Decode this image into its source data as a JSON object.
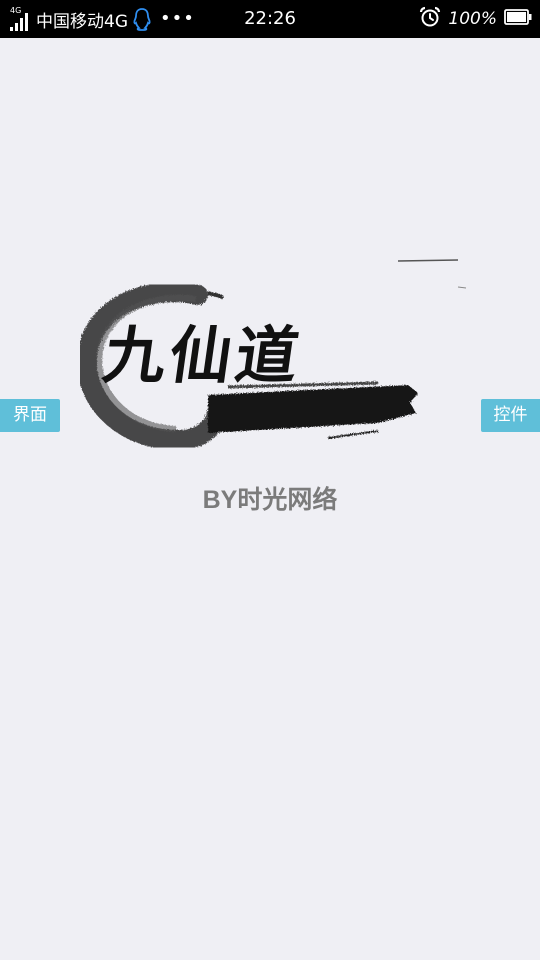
{
  "status_bar": {
    "network_badge": "4G",
    "carrier": "中国移动4G",
    "more_indicator": "•••",
    "time": "22:26",
    "battery_percent": "100%",
    "battery_level": 1.0,
    "icons": [
      "signal-icon",
      "qq-icon",
      "more-dots-icon",
      "alarm-clock-icon",
      "battery-icon"
    ]
  },
  "logo": {
    "text": "九仙道"
  },
  "byline": "BY时光网络",
  "side_tabs": {
    "left": "界面",
    "right": "控件"
  },
  "colors": {
    "background": "#efeff4",
    "status_bar": "#000000",
    "tab_accent": "#5fbfd9",
    "byline": "#7b7b7b",
    "ink": "#111111"
  }
}
